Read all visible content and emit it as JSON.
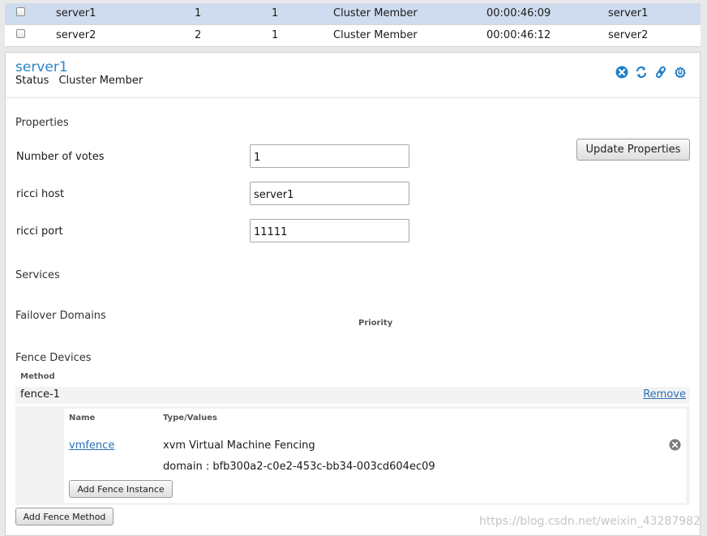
{
  "nodes": [
    {
      "name": "server1",
      "votes": "1",
      "online": "1",
      "status": "Cluster Member",
      "uptime": "00:00:46:09",
      "host": "server1",
      "selected": true
    },
    {
      "name": "server2",
      "votes": "2",
      "online": "1",
      "status": "Cluster Member",
      "uptime": "00:00:46:12",
      "host": "server2",
      "selected": false
    }
  ],
  "detail": {
    "title": "server1",
    "status_label": "Status",
    "status_value": "Cluster Member",
    "actions": [
      "leave-cluster-icon",
      "reboot-icon",
      "link-icon",
      "power-icon"
    ]
  },
  "properties": {
    "title": "Properties",
    "votes_label": "Number of votes",
    "votes_value": "1",
    "ricci_host_label": "ricci host",
    "ricci_host_value": "server1",
    "ricci_port_label": "ricci port",
    "ricci_port_value": "11111",
    "update_button": "Update Properties"
  },
  "services": {
    "title": "Services"
  },
  "failover": {
    "title": "Failover Domains",
    "priority_header": "Priority"
  },
  "fence": {
    "title": "Fence Devices",
    "method_header": "Method",
    "method_name": "fence-1",
    "remove_link": "Remove",
    "name_header": "Name",
    "type_header": "Type/Values",
    "instance_name": "vmfence",
    "instance_type": "xvm Virtual Machine Fencing",
    "instance_domain": "domain : bfb300a2-c0e2-453c-bb34-003cd604ec09",
    "add_instance_button": "Add Fence Instance",
    "add_method_button": "Add Fence Method"
  },
  "watermark": "https://blog.csdn.net/weixin_43287982",
  "colors": {
    "accent": "#2a86c6",
    "selected_row": "#cfdcef",
    "link": "#2a6fb5"
  }
}
